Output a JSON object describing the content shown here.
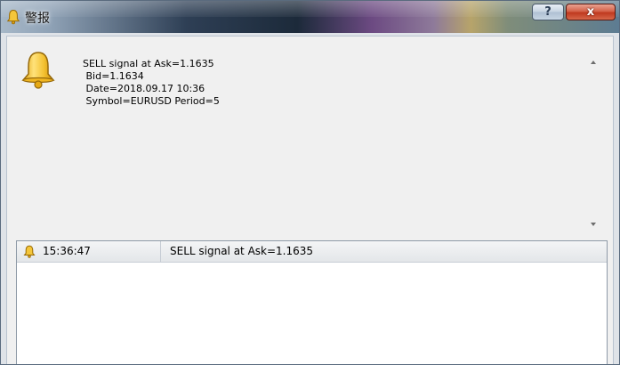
{
  "window": {
    "title": "警报",
    "help_label": "?",
    "close_label": "x"
  },
  "alert": {
    "message": "SELL signal at Ask=1.1635\n Bid=1.1634\n Date=2018.09.17 10:36\n Symbol=EURUSD Period=5"
  },
  "log": {
    "rows": [
      {
        "time": "15:36:47",
        "message": "SELL signal at Ask=1.1635"
      }
    ]
  },
  "icons": {
    "title": "bell-icon",
    "main": "bell-icon",
    "row": "bell-icon"
  },
  "colors": {
    "bell": "#f2c430",
    "close_button": "#c8422a"
  }
}
